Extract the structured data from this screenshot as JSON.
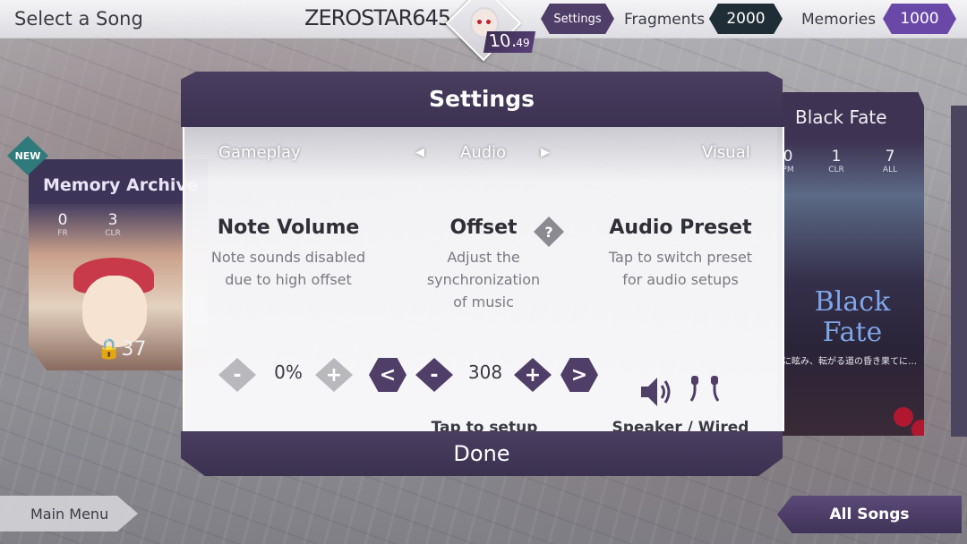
{
  "topbar": {
    "title": "Select a Song",
    "username": "ZEROSTAR645",
    "rating_main": "10.",
    "rating_decimal": "49",
    "settings_label": "Settings",
    "fragments_label": "Fragments",
    "fragments_value": "2000",
    "memories_label": "Memories",
    "memories_value": "1000"
  },
  "left_card": {
    "badge": "NEW",
    "title": "Memory Archive",
    "stats": [
      {
        "value": "0",
        "label": "FR"
      },
      {
        "value": "3",
        "label": "CLR"
      }
    ],
    "locked_count": "37"
  },
  "right_card": {
    "title": "Black Fate",
    "stats": [
      {
        "value": "0",
        "label": "PM"
      },
      {
        "value": "1",
        "label": "CLR"
      },
      {
        "value": "7",
        "label": "ALL"
      }
    ],
    "art_title": "Black Fate",
    "art_subtitle": "に眩み、転がる道の昏き果てに…"
  },
  "settings": {
    "title": "Settings",
    "tabs": {
      "left": "Gameplay",
      "current": "Audio",
      "right": "Visual"
    },
    "note_volume": {
      "heading": "Note Volume",
      "description_1": "Note sounds disabled",
      "description_2": "due to high offset",
      "value": "0%"
    },
    "offset": {
      "heading": "Offset",
      "help_symbol": "?",
      "description_1": "Adjust the synchronization",
      "description_2": "of music",
      "value": "308",
      "tap_setup": "Tap to setup"
    },
    "audio_preset": {
      "heading": "Audio Preset",
      "description_1": "Tap to switch preset",
      "description_2": "for audio setups",
      "label": "Speaker / Wired"
    },
    "done_label": "Done"
  },
  "bottom": {
    "main_menu": "Main Menu",
    "all_songs": "All Songs"
  },
  "colors": {
    "accent_purple": "#4f3e68",
    "memories_purple": "#6a48a8",
    "fragments_dark": "#1f2d36",
    "inactive_grey": "#b9b9bd"
  }
}
